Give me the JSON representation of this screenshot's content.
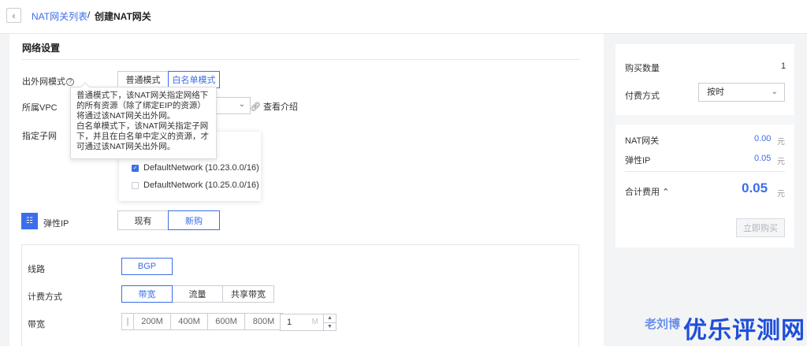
{
  "breadcrumb": {
    "back_icon": "chevron-left-icon",
    "parent": "NAT网关列表",
    "separator": "/",
    "current": "创建NAT网关"
  },
  "network": {
    "section_title": "网络设置",
    "egress_mode": {
      "label": "出外网模式",
      "help_icon": "question-circle-icon",
      "options": [
        "普通模式",
        "白名单模式"
      ],
      "selected": "白名单模式"
    },
    "vpc": {
      "label": "所属VPC",
      "link_icon": "link-icon",
      "link_text": "查看介绍"
    },
    "subnet": {
      "label": "指定子网",
      "items": [
        {
          "label": "DefaultNetwork (10.23.0.0/16)",
          "checked": true
        },
        {
          "label": "DefaultNetwork (10.25.0.0/16)",
          "checked": false
        }
      ]
    },
    "tooltip": {
      "para1": "普通模式下，该NAT网关指定网络下的所有资源（除了绑定EIP的资源）将通过该NAT网关出外网。",
      "para2": "白名单模式下，该NAT网关指定子网下，并且在白名单中定义的资源，才可通过该NAT网关出外网。"
    },
    "eip": {
      "icon": "network-tree-icon",
      "label": "弹性IP",
      "options": [
        "现有",
        "新购"
      ],
      "selected": "新购"
    },
    "line": {
      "label": "线路",
      "value": "BGP"
    },
    "billing": {
      "label": "计费方式",
      "options": [
        "带宽",
        "流量",
        "共享带宽"
      ],
      "selected": "带宽"
    },
    "bandwidth": {
      "label": "带宽",
      "options": [
        "200M",
        "400M",
        "600M",
        "800M"
      ],
      "value": "1",
      "unit": "M"
    }
  },
  "summary": {
    "quantity_label": "购买数量",
    "quantity_value": "1",
    "payment_label": "付费方式",
    "payment_value": "按时",
    "nat_label": "NAT网关",
    "nat_price": "0.00",
    "eip_label": "弹性IP",
    "eip_price": "0.05",
    "currency": "元",
    "total_label": "合计费用",
    "total_price": "0.05",
    "buy_button": "立即购买"
  },
  "watermark": {
    "small": "老刘博",
    "large": "优乐评测网"
  },
  "colors": {
    "accent": "#3b6ee8",
    "watermark": "#1f4fd8"
  }
}
